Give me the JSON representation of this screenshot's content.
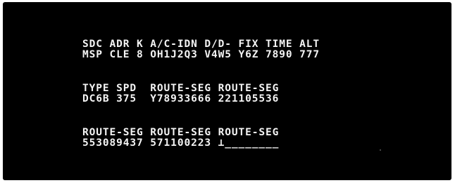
{
  "terminal": {
    "block1": {
      "header": "SDC ADR K A/C-IDN D/D- FIX TIME ALT",
      "values": "MSP CLE 8 OH1J2Q3 V4W5 Y6Z 7890 777"
    },
    "block2": {
      "header": "TYPE SPD  ROUTE-SEG ROUTE-SEG",
      "values": "DC6B 375  Y78933666 221105536"
    },
    "block3": {
      "header": "ROUTE-SEG ROUTE-SEG ROUTE-SEG",
      "values": "553089437 571100223 ⊥________"
    }
  }
}
